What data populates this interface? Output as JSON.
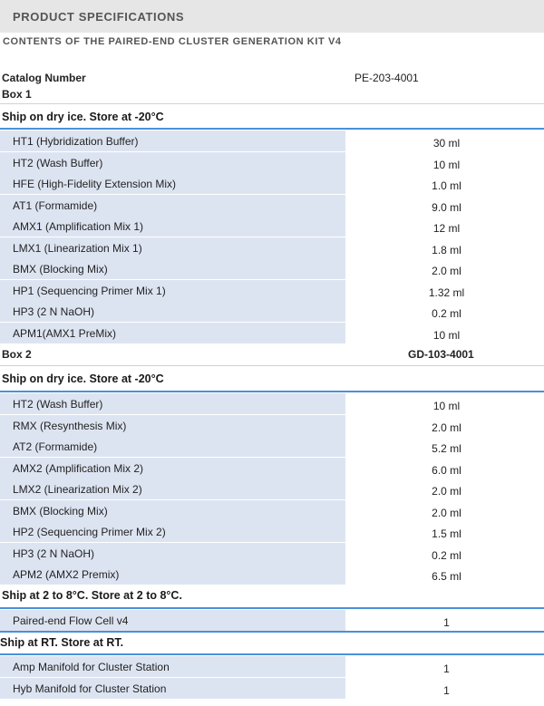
{
  "header": {
    "title": "PRODUCT SPECIFICATIONS"
  },
  "subtitle": "CONTENTS OF THE PAIRED-END CLUSTER GENERATION KIT V4",
  "catalog": {
    "label": "Catalog Number",
    "value": "PE-203-4001"
  },
  "box1": {
    "label": "Box 1",
    "ship": "Ship on dry ice. Store at -20°C",
    "items": [
      {
        "name": "HT1 (Hybridization Buffer)",
        "qty": "30 ml"
      },
      {
        "name": "HT2 (Wash Buffer)",
        "qty": "10 ml"
      },
      {
        "name": "HFE (High-Fidelity Extension Mix)",
        "qty": "1.0 ml"
      },
      {
        "name": "AT1 (Formamide)",
        "qty": "9.0 ml"
      },
      {
        "name": "AMX1 (Amplification Mix 1)",
        "qty": "12 ml"
      },
      {
        "name": "LMX1 (Linearization Mix 1)",
        "qty": "1.8 ml"
      },
      {
        "name": "BMX (Blocking Mix)",
        "qty": "2.0 ml"
      },
      {
        "name": "HP1 (Sequencing Primer Mix 1)",
        "qty": "1.32 ml"
      },
      {
        "name": "HP3 (2 N NaOH)",
        "qty": "0.2 ml"
      },
      {
        "name": "APM1(AMX1 PreMix)",
        "qty": "10 ml"
      }
    ]
  },
  "box2": {
    "label": "Box 2",
    "catalog": "GD-103-4001",
    "ship": "Ship on dry ice. Store at -20°C",
    "items": [
      {
        "name": "HT2 (Wash Buffer)",
        "qty": "10 ml"
      },
      {
        "name": "RMX (Resynthesis Mix)",
        "qty": "2.0 ml"
      },
      {
        "name": "AT2 (Formamide)",
        "qty": "5.2 ml"
      },
      {
        "name": "AMX2 (Amplification Mix 2)",
        "qty": "6.0 ml"
      },
      {
        "name": "LMX2 (Linearization Mix 2)",
        "qty": "2.0 ml"
      },
      {
        "name": "BMX (Blocking Mix)",
        "qty": "2.0 ml"
      },
      {
        "name": "HP2 (Sequencing Primer Mix 2)",
        "qty": "1.5 ml"
      },
      {
        "name": "HP3 (2 N NaOH)",
        "qty": "0.2 ml"
      },
      {
        "name": "APM2 (AMX2 Premix)",
        "qty": "6.5 ml"
      }
    ]
  },
  "cold": {
    "ship": "Ship at 2 to 8°C. Store at 2 to 8°C.",
    "items": [
      {
        "name": "Paired-end Flow Cell v4",
        "qty": "1"
      }
    ]
  },
  "rt": {
    "ship": "Ship at RT. Store at RT.",
    "items": [
      {
        "name": "Amp Manifold for Cluster Station",
        "qty": "1"
      },
      {
        "name": "Hyb Manifold for Cluster Station",
        "qty": "1"
      }
    ]
  }
}
